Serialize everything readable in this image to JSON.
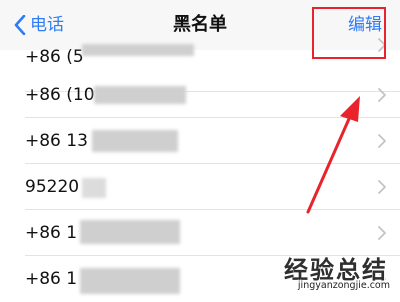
{
  "navbar": {
    "back_label": "电话",
    "title": "黑名单",
    "edit_label": "编辑",
    "accent_color": "#2f7cf6"
  },
  "blacklist": {
    "rows": [
      {
        "number": "+86 (5"
      },
      {
        "number": "+86 (10"
      },
      {
        "number": "+86 13"
      },
      {
        "number": "95220"
      },
      {
        "number": "+86 1"
      },
      {
        "number": "+86 1"
      }
    ]
  },
  "annotation": {
    "color": "#e8232b"
  },
  "watermark": {
    "brand": "经验总结",
    "url": "jingyanzongjie.com"
  }
}
